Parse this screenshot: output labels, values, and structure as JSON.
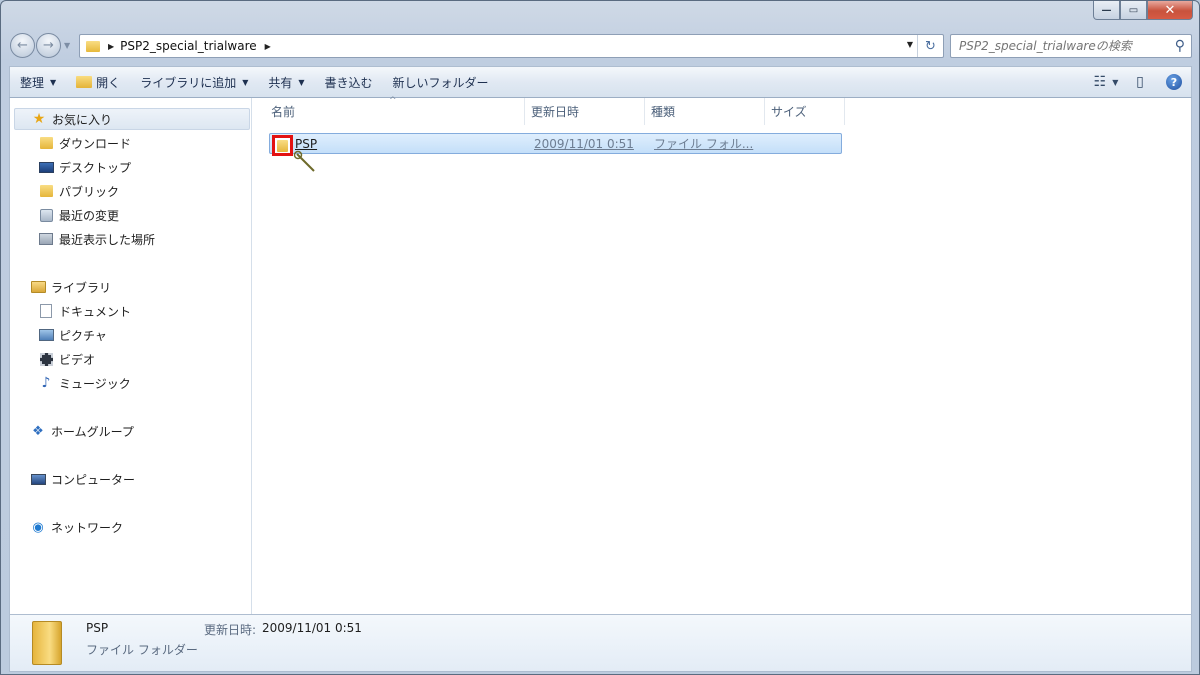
{
  "window": {
    "minimize_icon": "minimize-icon",
    "maximize_icon": "maximize-icon",
    "close_icon": "close-icon"
  },
  "address": {
    "path_segment": "PSP2_special_trialware",
    "search_placeholder": "PSP2_special_trialwareの検索"
  },
  "toolbar": {
    "organize": "整理",
    "open": "開く",
    "add_to_library": "ライブラリに追加",
    "share": "共有",
    "burn": "書き込む",
    "new_folder": "新しいフォルダー"
  },
  "navigation": {
    "favorites": {
      "label": "お気に入り",
      "items": [
        {
          "label": "ダウンロード",
          "icon": "download-folder-icon"
        },
        {
          "label": "デスクトップ",
          "icon": "desktop-icon"
        },
        {
          "label": "パブリック",
          "icon": "folder-icon"
        },
        {
          "label": "最近の変更",
          "icon": "recent-changes-icon"
        },
        {
          "label": "最近表示した場所",
          "icon": "recent-places-icon"
        }
      ]
    },
    "libraries": {
      "label": "ライブラリ",
      "items": [
        {
          "label": "ドキュメント",
          "icon": "document-icon"
        },
        {
          "label": "ピクチャ",
          "icon": "picture-icon"
        },
        {
          "label": "ビデオ",
          "icon": "video-icon"
        },
        {
          "label": "ミュージック",
          "icon": "music-icon"
        }
      ]
    },
    "homegroup": "ホームグループ",
    "computer": "コンピューター",
    "network": "ネットワーク"
  },
  "columns": {
    "name": "名前",
    "date": "更新日時",
    "type": "種類",
    "size": "サイズ"
  },
  "files": [
    {
      "name": "PSP",
      "date": "2009/11/01 0:51",
      "type": "ファイル フォル...",
      "selected": true
    }
  ],
  "details": {
    "name": "PSP",
    "type": "ファイル フォルダー",
    "date_label": "更新日時:",
    "date": "2009/11/01 0:51"
  },
  "colors": {
    "selection_bg": "#c4dff9",
    "highlight_box": "#e31212",
    "folder": "#e5b53b"
  }
}
